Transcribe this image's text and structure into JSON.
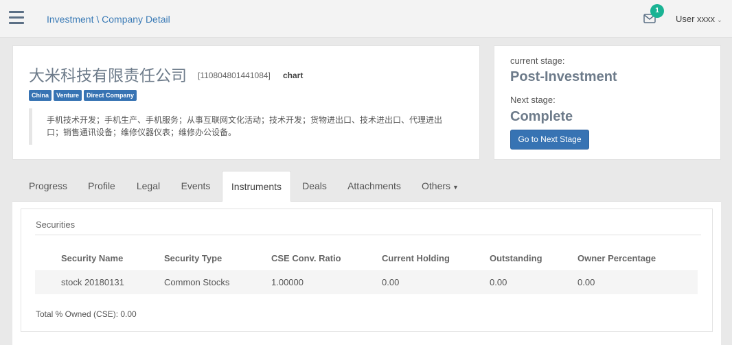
{
  "header": {
    "breadcrumb": "Investment \\ Company Detail",
    "notification_count": "1",
    "user": "User xxxx"
  },
  "company": {
    "name": "大米科技有限责任公司",
    "id": "[110804801441084]",
    "chart_link": "chart",
    "tags": [
      "China",
      "Venture",
      "Direct Company"
    ],
    "description_line1": "手机技术开发；手机生产、手机服务；从事互联网文化活动；技术开发；货物进出口、技术进出口、代理进出",
    "description_line2": "口；销售通讯设备；维修仪器仪表；维修办公设备。"
  },
  "stage": {
    "current_label": "current stage:",
    "current_value": "Post-Investment",
    "next_label": "Next stage:",
    "next_value": "Complete",
    "button_label": "Go to Next Stage"
  },
  "tabs": [
    "Progress",
    "Profile",
    "Legal",
    "Events",
    "Instruments",
    "Deals",
    "Attachments",
    "Others"
  ],
  "active_tab": "Instruments",
  "securities": {
    "title": "Securities",
    "columns": [
      "Security Name",
      "Security Type",
      "CSE Conv. Ratio",
      "Current Holding",
      "Outstanding",
      "Owner Percentage"
    ],
    "rows": [
      [
        "stock 20180131",
        "Common Stocks",
        "1.00000",
        "0.00",
        "0.00",
        "0.00"
      ]
    ],
    "total": "Total % Owned (CSE): 0.00"
  },
  "colors": {
    "primary": "#3773b3",
    "badge": "#1ab394",
    "heading": "#6d7b8a"
  }
}
